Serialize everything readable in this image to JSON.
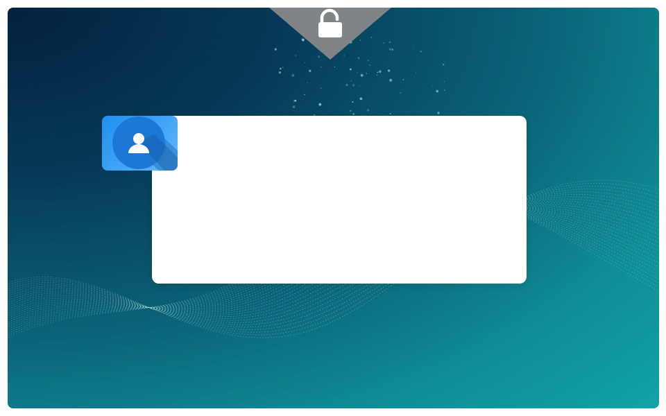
{
  "screen": {
    "name": "login-screen",
    "background_colors": [
      "#03213f",
      "#063a58",
      "#0a6378",
      "#11a3a9"
    ],
    "wave_color": "#9fe4dc"
  },
  "lock_badge": {
    "icon": "unlocked-padlock-icon",
    "color": "#8a8a8a",
    "icon_color": "#ffffff"
  },
  "avatar": {
    "icon": "user-icon",
    "tile_color": "#2a97f2",
    "circle_color": "#1c78d4",
    "icon_color": "#ffffff"
  },
  "login_panel": {
    "color": "#ffffff"
  }
}
